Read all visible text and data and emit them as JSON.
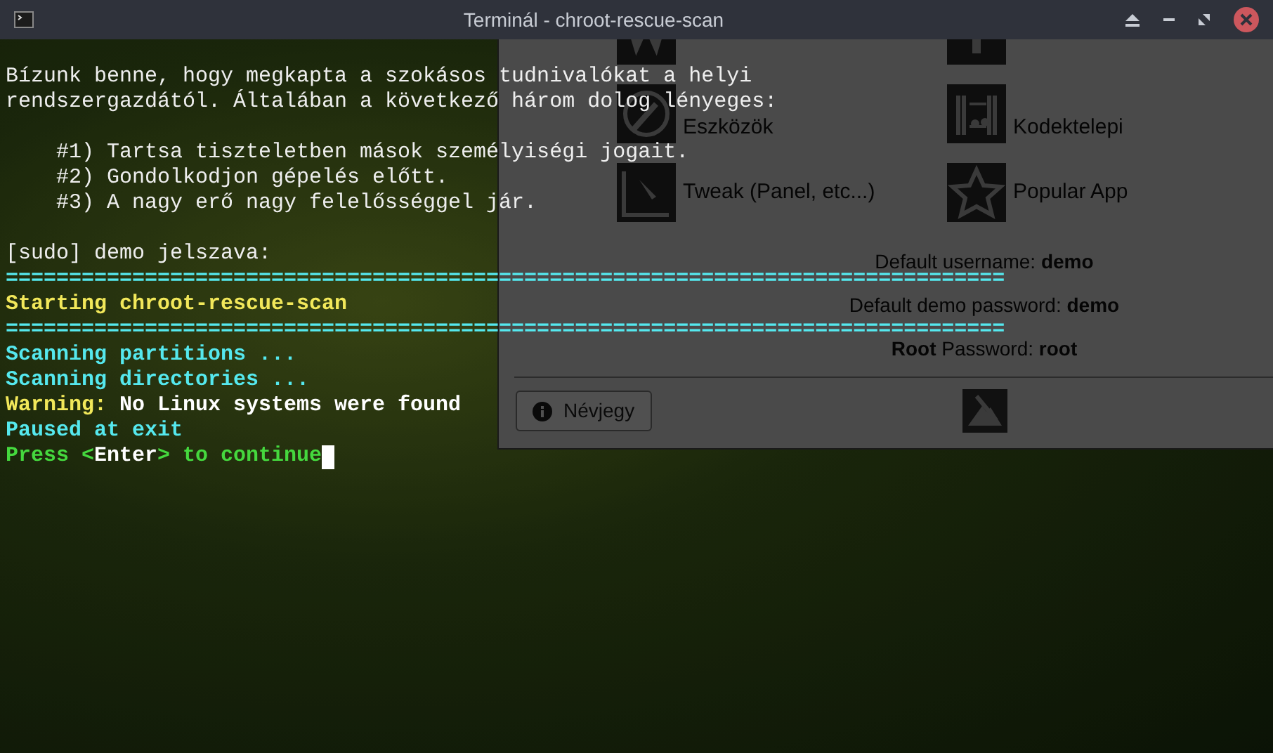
{
  "window": {
    "title": "Terminál - chroot-rescue-scan"
  },
  "background_window": {
    "tools": [
      {
        "kind": "cut"
      },
      {
        "kind": "cut"
      },
      {
        "kind": "tile",
        "label": "Eszközök"
      },
      {
        "kind": "tile",
        "label": "Kodektelepi"
      },
      {
        "kind": "tile",
        "label": "Tweak (Panel, etc...)"
      },
      {
        "kind": "tile",
        "label": "Popular App"
      }
    ],
    "credentials": [
      "Default username: **demo**",
      "Default demo password: **demo**",
      "**Root** Password: **root**"
    ],
    "about_button": "Névjegy"
  },
  "terminal": {
    "lines": [
      {
        "space_before": true,
        "segments": [
          {
            "kind": "text",
            "text": "Bízunk benne, hogy megkapta a szokásos tudnivalókat a helyi"
          }
        ]
      },
      {
        "segments": [
          {
            "kind": "text",
            "text": "rendszergazdától. Általában a következő három dolog lényeges:"
          }
        ]
      },
      {
        "space_before": true,
        "segments": [
          {
            "kind": "text",
            "text": "    #1) Tartsa tiszteletben mások személyiségi jogait."
          }
        ]
      },
      {
        "segments": [
          {
            "kind": "text",
            "text": "    #2) Gondolkodjon gépelés előtt."
          }
        ]
      },
      {
        "segments": [
          {
            "kind": "text",
            "text": "    #3) A nagy erő nagy felelősséggel jár."
          }
        ]
      },
      {
        "space_before": true,
        "segments": [
          {
            "kind": "text",
            "text": "[sudo] demo jelszava:"
          }
        ]
      },
      {
        "segments": [
          {
            "kind": "rule",
            "text": "==============================================================================="
          }
        ]
      },
      {
        "segments": [
          {
            "kind": "title",
            "text": "Starting chroot-rescue-scan"
          }
        ]
      },
      {
        "segments": [
          {
            "kind": "rule",
            "text": "==============================================================================="
          }
        ]
      },
      {
        "segments": [
          {
            "kind": "info",
            "text": "Scanning partitions ..."
          }
        ]
      },
      {
        "segments": [
          {
            "kind": "info",
            "text": "Scanning directories ..."
          }
        ]
      },
      {
        "segments": [
          {
            "kind": "warning",
            "text": "Warning:"
          },
          {
            "kind": "emphasis",
            "text": " No Linux systems were found"
          }
        ]
      },
      {
        "segments": [
          {
            "kind": "info",
            "text": "Paused at exit"
          }
        ]
      },
      {
        "segments": [
          {
            "kind": "prompt",
            "text": "Press <"
          },
          {
            "kind": "emphasis",
            "text": "Enter"
          },
          {
            "kind": "prompt",
            "text": "> to continue"
          }
        ],
        "cursor": true
      }
    ]
  }
}
